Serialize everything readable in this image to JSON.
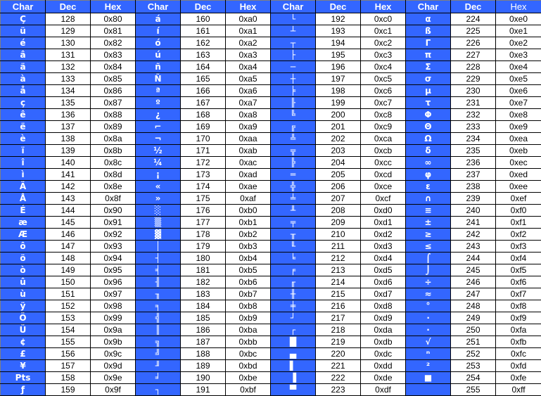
{
  "headers": [
    "Char",
    "Dec",
    "Hex",
    "Char",
    "Dec",
    "Hex",
    "Char",
    "Dec",
    "Hex",
    "Char",
    "Dec",
    "Hex"
  ],
  "groups": [
    {
      "rows": [
        {
          "char": "Ç",
          "dec": "128",
          "hex": "0x80"
        },
        {
          "char": "ü",
          "dec": "129",
          "hex": "0x81"
        },
        {
          "char": "é",
          "dec": "130",
          "hex": "0x82"
        },
        {
          "char": "â",
          "dec": "131",
          "hex": "0x83"
        },
        {
          "char": "ä",
          "dec": "132",
          "hex": "0x84"
        },
        {
          "char": "à",
          "dec": "133",
          "hex": "0x85"
        },
        {
          "char": "å",
          "dec": "134",
          "hex": "0x86"
        },
        {
          "char": "ç",
          "dec": "135",
          "hex": "0x87"
        },
        {
          "char": "ê",
          "dec": "136",
          "hex": "0x88"
        },
        {
          "char": "ë",
          "dec": "137",
          "hex": "0x89"
        },
        {
          "char": "è",
          "dec": "138",
          "hex": "0x8a"
        },
        {
          "char": "ï",
          "dec": "139",
          "hex": "0x8b"
        },
        {
          "char": "î",
          "dec": "140",
          "hex": "0x8c"
        },
        {
          "char": "ì",
          "dec": "141",
          "hex": "0x8d"
        },
        {
          "char": "Ä",
          "dec": "142",
          "hex": "0x8e"
        },
        {
          "char": "Å",
          "dec": "143",
          "hex": "0x8f"
        },
        {
          "char": "É",
          "dec": "144",
          "hex": "0x90"
        },
        {
          "char": "æ",
          "dec": "145",
          "hex": "0x91"
        },
        {
          "char": "Æ",
          "dec": "146",
          "hex": "0x92"
        },
        {
          "char": "ô",
          "dec": "147",
          "hex": "0x93"
        },
        {
          "char": "ö",
          "dec": "148",
          "hex": "0x94"
        },
        {
          "char": "ò",
          "dec": "149",
          "hex": "0x95"
        },
        {
          "char": "û",
          "dec": "150",
          "hex": "0x96"
        },
        {
          "char": "ù",
          "dec": "151",
          "hex": "0x97"
        },
        {
          "char": "ÿ",
          "dec": "152",
          "hex": "0x98"
        },
        {
          "char": "Ö",
          "dec": "153",
          "hex": "0x99"
        },
        {
          "char": "Ü",
          "dec": "154",
          "hex": "0x9a"
        },
        {
          "char": "¢",
          "dec": "155",
          "hex": "0x9b"
        },
        {
          "char": "£",
          "dec": "156",
          "hex": "0x9c"
        },
        {
          "char": "¥",
          "dec": "157",
          "hex": "0x9d"
        },
        {
          "char": "Pts",
          "dec": "158",
          "hex": "0x9e"
        },
        {
          "char": "ƒ",
          "dec": "159",
          "hex": "0x9f"
        }
      ]
    },
    {
      "rows": [
        {
          "char": "á",
          "dec": "160",
          "hex": "0xa0"
        },
        {
          "char": "í",
          "dec": "161",
          "hex": "0xa1"
        },
        {
          "char": "ó",
          "dec": "162",
          "hex": "0xa2"
        },
        {
          "char": "ú",
          "dec": "163",
          "hex": "0xa3"
        },
        {
          "char": "ñ",
          "dec": "164",
          "hex": "0xa4"
        },
        {
          "char": "Ñ",
          "dec": "165",
          "hex": "0xa5"
        },
        {
          "char": "ª",
          "dec": "166",
          "hex": "0xa6"
        },
        {
          "char": "º",
          "dec": "167",
          "hex": "0xa7"
        },
        {
          "char": "¿",
          "dec": "168",
          "hex": "0xa8"
        },
        {
          "char": "⌐",
          "dec": "169",
          "hex": "0xa9"
        },
        {
          "char": "¬",
          "dec": "170",
          "hex": "0xaa"
        },
        {
          "char": "½",
          "dec": "171",
          "hex": "0xab"
        },
        {
          "char": "¼",
          "dec": "172",
          "hex": "0xac"
        },
        {
          "char": "¡",
          "dec": "173",
          "hex": "0xad"
        },
        {
          "char": "«",
          "dec": "174",
          "hex": "0xae"
        },
        {
          "char": "»",
          "dec": "175",
          "hex": "0xaf"
        },
        {
          "char": "░",
          "dec": "176",
          "hex": "0xb0"
        },
        {
          "char": "▒",
          "dec": "177",
          "hex": "0xb1"
        },
        {
          "char": "▓",
          "dec": "178",
          "hex": "0xb2"
        },
        {
          "char": "│",
          "dec": "179",
          "hex": "0xb3"
        },
        {
          "char": "┤",
          "dec": "180",
          "hex": "0xb4"
        },
        {
          "char": "╡",
          "dec": "181",
          "hex": "0xb5"
        },
        {
          "char": "╢",
          "dec": "182",
          "hex": "0xb6"
        },
        {
          "char": "╖",
          "dec": "183",
          "hex": "0xb7"
        },
        {
          "char": "╕",
          "dec": "184",
          "hex": "0xb8"
        },
        {
          "char": "╣",
          "dec": "185",
          "hex": "0xb9"
        },
        {
          "char": "║",
          "dec": "186",
          "hex": "0xba"
        },
        {
          "char": "╗",
          "dec": "187",
          "hex": "0xbb"
        },
        {
          "char": "╝",
          "dec": "188",
          "hex": "0xbc"
        },
        {
          "char": "╜",
          "dec": "189",
          "hex": "0xbd"
        },
        {
          "char": "╛",
          "dec": "190",
          "hex": "0xbe"
        },
        {
          "char": "┐",
          "dec": "191",
          "hex": "0xbf"
        }
      ]
    },
    {
      "rows": [
        {
          "char": "└",
          "dec": "192",
          "hex": "0xc0"
        },
        {
          "char": "┴",
          "dec": "193",
          "hex": "0xc1"
        },
        {
          "char": "┬",
          "dec": "194",
          "hex": "0xc2"
        },
        {
          "char": "├",
          "dec": "195",
          "hex": "0xc3"
        },
        {
          "char": "─",
          "dec": "196",
          "hex": "0xc4"
        },
        {
          "char": "┼",
          "dec": "197",
          "hex": "0xc5"
        },
        {
          "char": "╞",
          "dec": "198",
          "hex": "0xc6"
        },
        {
          "char": "╟",
          "dec": "199",
          "hex": "0xc7"
        },
        {
          "char": "╚",
          "dec": "200",
          "hex": "0xc8"
        },
        {
          "char": "╔",
          "dec": "201",
          "hex": "0xc9"
        },
        {
          "char": "╩",
          "dec": "202",
          "hex": "0xca"
        },
        {
          "char": "╦",
          "dec": "203",
          "hex": "0xcb"
        },
        {
          "char": "╠",
          "dec": "204",
          "hex": "0xcc"
        },
        {
          "char": "═",
          "dec": "205",
          "hex": "0xcd"
        },
        {
          "char": "╬",
          "dec": "206",
          "hex": "0xce"
        },
        {
          "char": "╧",
          "dec": "207",
          "hex": "0xcf"
        },
        {
          "char": "╨",
          "dec": "208",
          "hex": "0xd0"
        },
        {
          "char": "╤",
          "dec": "209",
          "hex": "0xd1"
        },
        {
          "char": "╥",
          "dec": "210",
          "hex": "0xd2"
        },
        {
          "char": "╙",
          "dec": "211",
          "hex": "0xd3"
        },
        {
          "char": "╘",
          "dec": "212",
          "hex": "0xd4"
        },
        {
          "char": "╒",
          "dec": "213",
          "hex": "0xd5"
        },
        {
          "char": "╓",
          "dec": "214",
          "hex": "0xd6"
        },
        {
          "char": "╫",
          "dec": "215",
          "hex": "0xd7"
        },
        {
          "char": "╪",
          "dec": "216",
          "hex": "0xd8"
        },
        {
          "char": "┘",
          "dec": "217",
          "hex": "0xd9"
        },
        {
          "char": "┌",
          "dec": "218",
          "hex": "0xda"
        },
        {
          "char": "█",
          "dec": "219",
          "hex": "0xdb"
        },
        {
          "char": "▄",
          "dec": "220",
          "hex": "0xdc"
        },
        {
          "char": "▌",
          "dec": "221",
          "hex": "0xdd"
        },
        {
          "char": "▐",
          "dec": "222",
          "hex": "0xde"
        },
        {
          "char": "▀",
          "dec": "223",
          "hex": "0xdf"
        }
      ]
    },
    {
      "rows": [
        {
          "char": "α",
          "dec": "224",
          "hex": "0xe0"
        },
        {
          "char": "ß",
          "dec": "225",
          "hex": "0xe1"
        },
        {
          "char": "Γ",
          "dec": "226",
          "hex": "0xe2"
        },
        {
          "char": "π",
          "dec": "227",
          "hex": "0xe3"
        },
        {
          "char": "Σ",
          "dec": "228",
          "hex": "0xe4"
        },
        {
          "char": "σ",
          "dec": "229",
          "hex": "0xe5"
        },
        {
          "char": "µ",
          "dec": "230",
          "hex": "0xe6"
        },
        {
          "char": "τ",
          "dec": "231",
          "hex": "0xe7"
        },
        {
          "char": "Φ",
          "dec": "232",
          "hex": "0xe8"
        },
        {
          "char": "Θ",
          "dec": "233",
          "hex": "0xe9"
        },
        {
          "char": "Ω",
          "dec": "234",
          "hex": "0xea"
        },
        {
          "char": "δ",
          "dec": "235",
          "hex": "0xeb"
        },
        {
          "char": "∞",
          "dec": "236",
          "hex": "0xec"
        },
        {
          "char": "φ",
          "dec": "237",
          "hex": "0xed"
        },
        {
          "char": "ε",
          "dec": "238",
          "hex": "0xee"
        },
        {
          "char": "∩",
          "dec": "239",
          "hex": "0xef"
        },
        {
          "char": "≡",
          "dec": "240",
          "hex": "0xf0"
        },
        {
          "char": "±",
          "dec": "241",
          "hex": "0xf1"
        },
        {
          "char": "≥",
          "dec": "242",
          "hex": "0xf2"
        },
        {
          "char": "≤",
          "dec": "243",
          "hex": "0xf3"
        },
        {
          "char": "⌠",
          "dec": "244",
          "hex": "0xf4"
        },
        {
          "char": "⌡",
          "dec": "245",
          "hex": "0xf5"
        },
        {
          "char": "÷",
          "dec": "246",
          "hex": "0xf6"
        },
        {
          "char": "≈",
          "dec": "247",
          "hex": "0xf7"
        },
        {
          "char": "°",
          "dec": "248",
          "hex": "0xf8"
        },
        {
          "char": "∙",
          "dec": "249",
          "hex": "0xf9"
        },
        {
          "char": "·",
          "dec": "250",
          "hex": "0xfa"
        },
        {
          "char": "√",
          "dec": "251",
          "hex": "0xfb"
        },
        {
          "char": "ⁿ",
          "dec": "252",
          "hex": "0xfc"
        },
        {
          "char": "²",
          "dec": "253",
          "hex": "0xfd"
        },
        {
          "char": "■",
          "dec": "254",
          "hex": "0xfe"
        },
        {
          "char": "",
          "dec": "255",
          "hex": "0xff"
        }
      ]
    }
  ],
  "colors": {
    "char_cell_bg": "#3366ff",
    "char_cell_text": "#ffffff",
    "value_cell_bg": "#ffffff",
    "value_cell_text": "#000000",
    "grid_line": "#000000"
  }
}
